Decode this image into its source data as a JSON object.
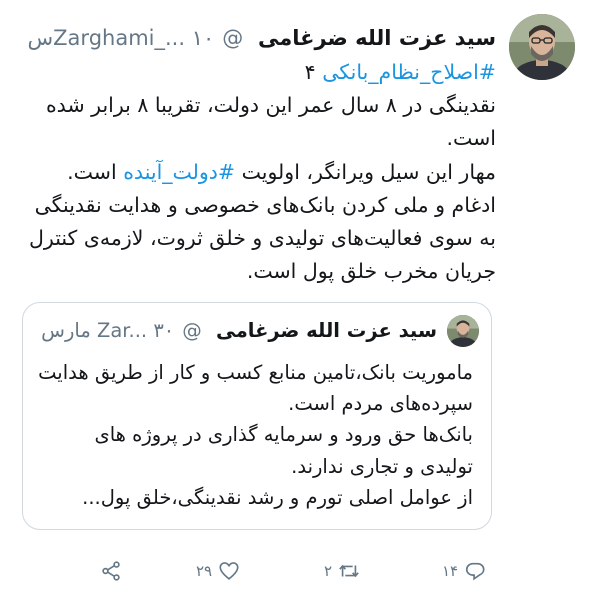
{
  "tweet": {
    "author": {
      "name": "سید عزت الله ضرغامی",
      "handle": "@Zarghami_...",
      "time": "۱۰س"
    },
    "body": {
      "line1_tag": "#اصلاح_نظام_بانکی",
      "line1_rest": " ۴",
      "para1": "نقدینگی در ۸ سال عمر این دولت، تقریبا ۸ برابر شده است.",
      "para2_a": "مهار این سیل ویرانگر، اولویت ",
      "para2_tag": "#دولت_آینده",
      "para2_b": " است.",
      "para3": "ادغام و ملی کردن بانک‌های خصوصی و هدایت نقدینگی به سوی فعالیت‌های تولیدی و خلق ثروت، لازمه‌ی کنترل جریان مخرب خلق پول است."
    },
    "quoted": {
      "author": {
        "name": "سید عزت الله ضرغامی",
        "handle": "@Zar...",
        "time": "۳۰ مارس"
      },
      "para1": "ماموریت بانک،تامین منابع کسب و کار از طریق هدایت سپرده‌های مردم است.",
      "para2": "بانک‌ها حق ورود و سرمایه گذاری در پروژه های تولیدی و تجاری ندارند.",
      "para3": "از عوامل اصلی تورم و رشد نقدینگی،خلق پول..."
    },
    "actions": {
      "reply": {
        "icon": "reply-icon",
        "count": "۱۴"
      },
      "retweet": {
        "icon": "retweet-icon",
        "count": "۲"
      },
      "like": {
        "icon": "heart-icon",
        "count": "۲۹"
      },
      "share": {
        "icon": "share-icon"
      }
    }
  }
}
